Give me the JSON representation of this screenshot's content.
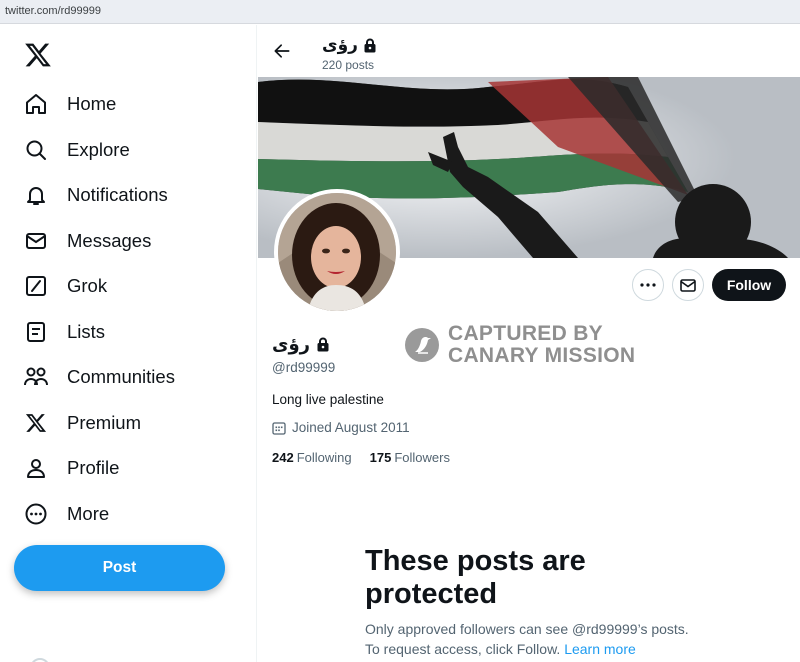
{
  "browser": {
    "url": "twitter.com/rd99999"
  },
  "nav": {
    "items": [
      {
        "label": "Home",
        "icon": "home-icon"
      },
      {
        "label": "Explore",
        "icon": "search-icon"
      },
      {
        "label": "Notifications",
        "icon": "bell-icon"
      },
      {
        "label": "Messages",
        "icon": "envelope-icon"
      },
      {
        "label": "Grok",
        "icon": "grok-icon"
      },
      {
        "label": "Lists",
        "icon": "list-icon"
      },
      {
        "label": "Communities",
        "icon": "people-icon"
      },
      {
        "label": "Premium",
        "icon": "x-logo-icon"
      },
      {
        "label": "Profile",
        "icon": "person-icon"
      },
      {
        "label": "More",
        "icon": "more-circle-icon"
      }
    ],
    "post_label": "Post"
  },
  "header": {
    "name": "رؤى",
    "posts_count": "220 posts"
  },
  "profile": {
    "name": "رؤى",
    "handle": "@rd99999",
    "bio": "Long live palestine",
    "joined": "Joined August 2011",
    "following_count": "242",
    "following_label": "Following",
    "followers_count": "175",
    "followers_label": "Followers",
    "follow_label": "Follow"
  },
  "watermark": {
    "line1": "CAPTURED BY",
    "line2": "CANARY MISSION"
  },
  "protected": {
    "title": "These posts are protected",
    "text_1": "Only approved followers can see @rd99999’s posts.",
    "text_2": "To request access, click Follow.",
    "learn_more": "Learn more"
  },
  "colors": {
    "accent": "#1d9bf0",
    "text": "#0f1419",
    "muted": "#536471",
    "follow_bg": "#0f1419"
  }
}
